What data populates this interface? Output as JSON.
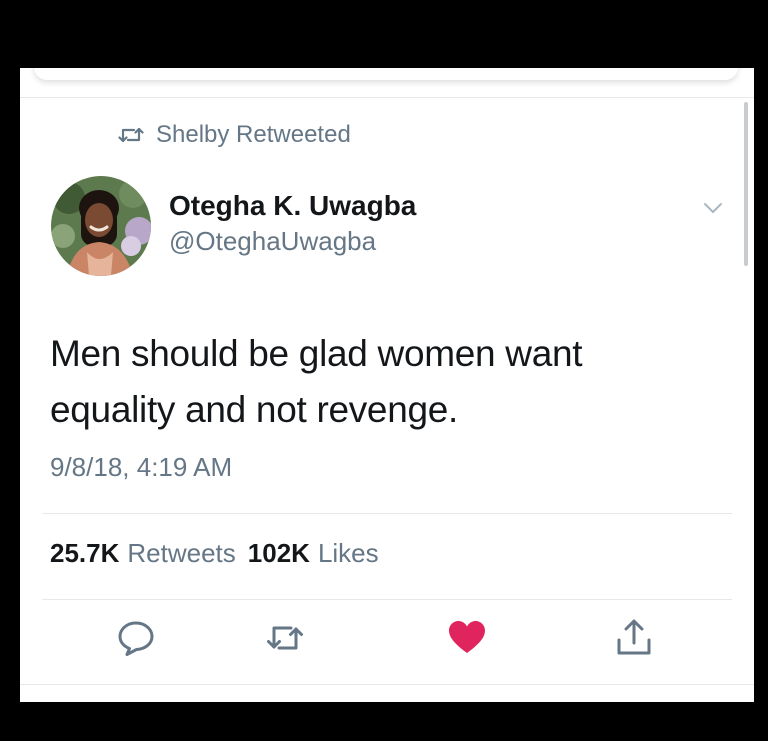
{
  "retweet_banner": {
    "text": "Shelby Retweeted",
    "icon": "retweet-icon"
  },
  "author": {
    "name": "Otegha K. Uwagba",
    "handle": "@OteghaUwagba"
  },
  "tweet": {
    "lines": [
      "Men should be glad women want",
      "equality and not revenge."
    ],
    "timestamp": "9/8/18, 4:19 AM"
  },
  "stats": {
    "retweets_count": "25.7K",
    "retweets_label": "Retweets",
    "likes_count": "102K",
    "likes_label": "Likes"
  },
  "actions": [
    {
      "name": "reply",
      "icon": "reply-icon"
    },
    {
      "name": "retweet",
      "icon": "retweet-icon"
    },
    {
      "name": "like",
      "icon": "heart-icon",
      "liked": true
    },
    {
      "name": "share",
      "icon": "share-icon"
    }
  ],
  "colors": {
    "text_primary": "#14171a",
    "text_secondary": "#657786",
    "like_red": "#e0245e",
    "divider": "#e6e9ec"
  }
}
